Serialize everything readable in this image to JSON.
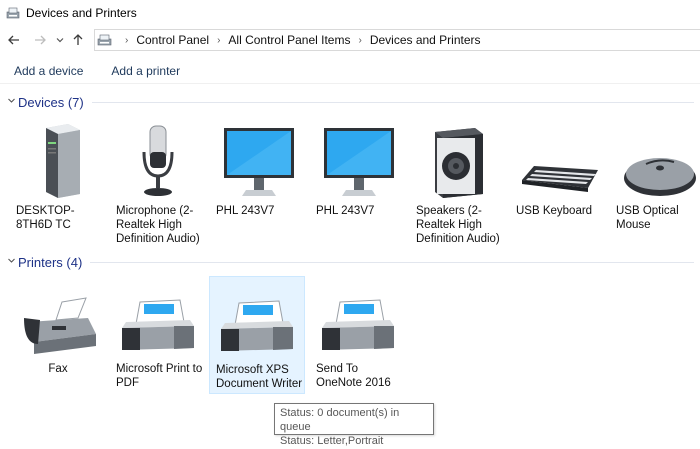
{
  "window": {
    "title": "Devices and Printers"
  },
  "nav": {
    "back_icon": "arrow-left-icon",
    "forward_icon": "arrow-right-icon",
    "recent_icon": "chevron-down-icon",
    "up_icon": "arrow-up-icon"
  },
  "address": {
    "breadcrumbs": [
      "Control Panel",
      "All Control Panel Items",
      "Devices and Printers"
    ]
  },
  "toolbar": {
    "add_device": "Add a device",
    "add_printer": "Add a printer"
  },
  "groups": {
    "devices": {
      "title": "Devices (7)",
      "items": [
        {
          "label": "DESKTOP-8TH6D TC",
          "icon": "computer-tower-icon"
        },
        {
          "label": "Microphone (2- Realtek High Definition Audio)",
          "icon": "microphone-icon"
        },
        {
          "label": "PHL 243V7",
          "icon": "monitor-icon"
        },
        {
          "label": "PHL 243V7",
          "icon": "monitor-icon"
        },
        {
          "label": "Speakers (2- Realtek High Definition Audio)",
          "icon": "speaker-icon"
        },
        {
          "label": "USB Keyboard",
          "icon": "keyboard-icon"
        },
        {
          "label": "USB Optical Mouse",
          "icon": "mouse-icon"
        }
      ]
    },
    "printers": {
      "title": "Printers (4)",
      "items": [
        {
          "label": "Fax",
          "icon": "fax-icon"
        },
        {
          "label": "Microsoft Print to PDF",
          "icon": "printer-icon"
        },
        {
          "label": "Microsoft XPS Document Writer",
          "icon": "printer-icon",
          "selected": true
        },
        {
          "label": "Send To OneNote 2016",
          "icon": "printer-icon"
        }
      ]
    }
  },
  "tooltip": {
    "line1": "Status: 0 document(s) in queue",
    "line2": "Status: Letter,Portrait"
  },
  "colors": {
    "group_title": "#1e3287",
    "command_text": "#1e395b",
    "selection_bg": "#e5f3ff",
    "monitor_screen": "#2ea8f0"
  }
}
